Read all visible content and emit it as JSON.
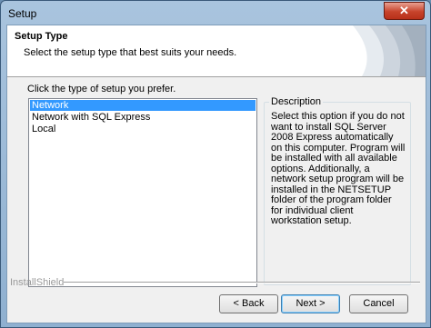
{
  "window": {
    "title": "Setup",
    "close_glyph": "✕"
  },
  "header": {
    "title": "Setup Type",
    "subtitle": "Select the setup type that best suits your needs."
  },
  "prompt": "Click the type of setup you prefer.",
  "list": {
    "items": [
      "Network",
      "Network with SQL Express",
      "Local"
    ],
    "selected": "Network"
  },
  "description": {
    "label": "Description",
    "text": "Select this option if you do not want to install SQL Server 2008 Express automatically on this computer. Program will be installed with all available options. Additionally, a network setup program will be installed in the NETSETUP folder of the program folder for individual client workstation setup."
  },
  "footer": {
    "brand": "InstallShield"
  },
  "buttons": {
    "back": "< Back",
    "next": "Next >",
    "cancel": "Cancel"
  },
  "colors": {
    "selection": "#3399ff",
    "close_button": "#c7432b"
  }
}
